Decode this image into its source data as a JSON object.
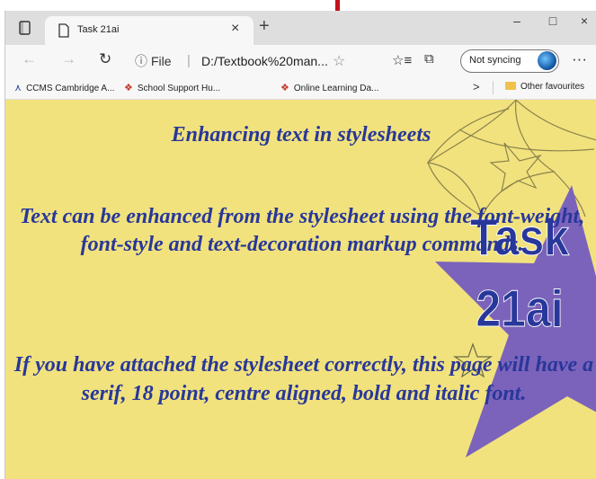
{
  "tab": {
    "title": "Task 21ai",
    "close": "×"
  },
  "window": {
    "new_tab": "+",
    "minimize": "–",
    "maximize": "□",
    "close": "×"
  },
  "address_bar": {
    "info_icon": "ⓘ",
    "scheme": "File",
    "separator": "|",
    "url": "D:/Textbook%20man...",
    "favorite_star": "☆"
  },
  "toolbar": {
    "sync_label": "Not syncing",
    "more": "···",
    "favorites_icon": "☆≡",
    "collections_icon": "⧉"
  },
  "favorites": [
    {
      "icon": "⋏",
      "label": "CCMS Cambridge A..."
    },
    {
      "icon": "❖",
      "label": "School Support Hu..."
    },
    {
      "icon": "❖",
      "label": "Online Learning Da..."
    }
  ],
  "favorites_more": ">",
  "other_favourites": "Other favourites",
  "page": {
    "heading": "Enhancing text in stylesheets",
    "paragraph1": "Text can be enhanced from the stylesheet using the font-weight, font-style and text-decoration markup commands.",
    "paragraph2": "If you have attached the stylesheet correctly, this page will have a serif, 18 point, centre aligned, bold and italic font.",
    "logo_line1": "Task",
    "logo_line2": "21ai"
  },
  "colors": {
    "page_background": "#f1e27d",
    "text": "#28379a",
    "star": "#7b63bb",
    "arrow": "#c6111c"
  }
}
